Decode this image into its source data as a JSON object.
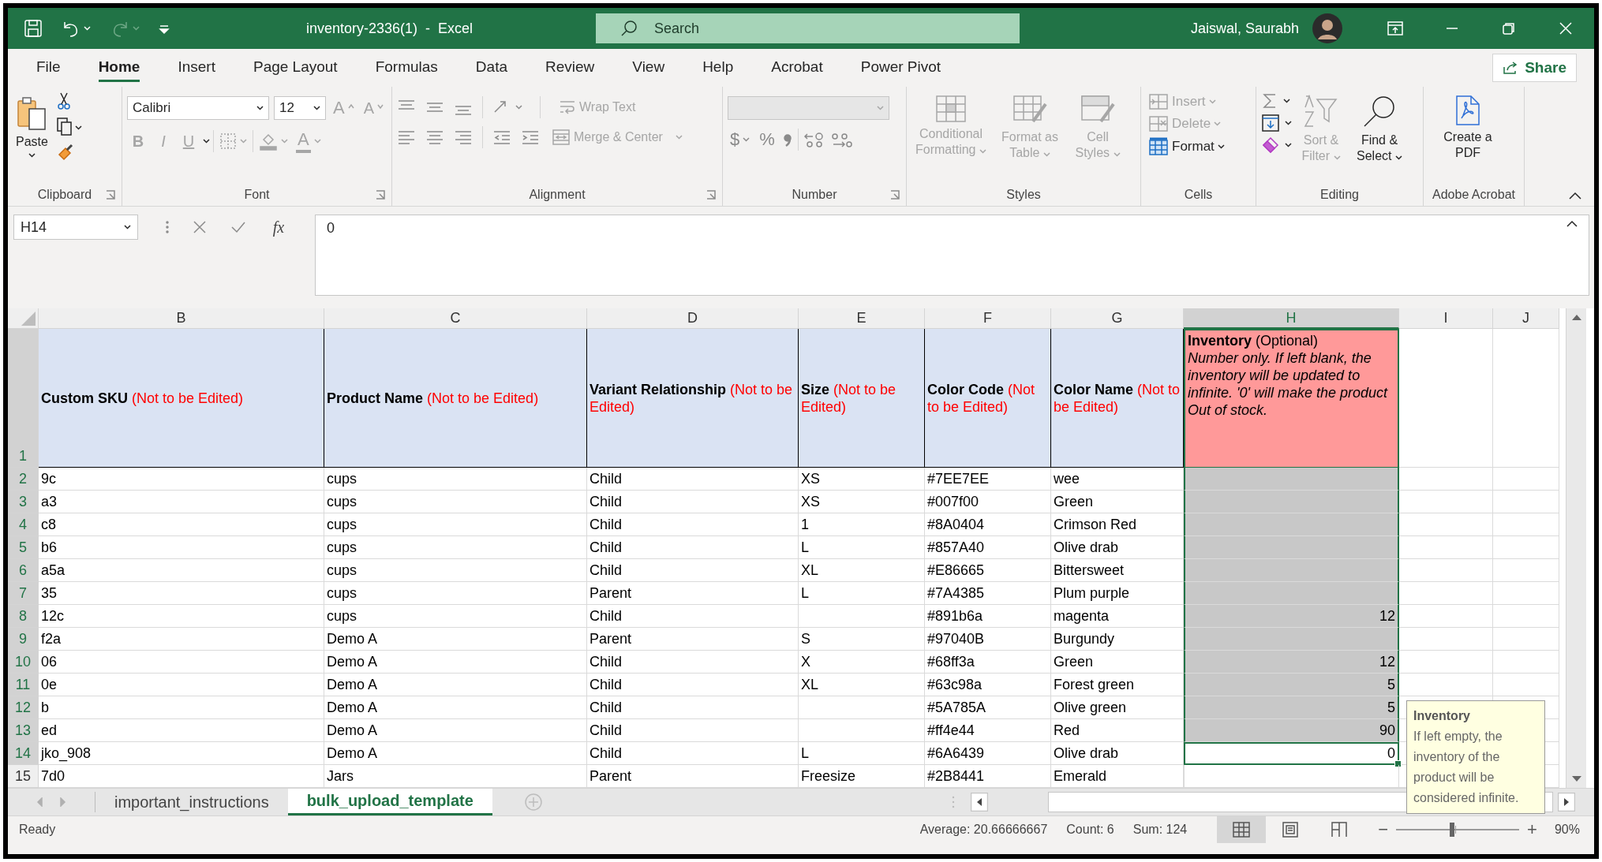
{
  "window": {
    "title": "inventory-2336(1)  -  Excel",
    "search_placeholder": "Search",
    "user": "Jaiswal, Saurabh"
  },
  "quick_access": [
    {
      "kind": "save",
      "disabled": false
    },
    {
      "kind": "undo",
      "disabled": false
    },
    {
      "kind": "redo",
      "disabled": true
    },
    {
      "kind": "customize",
      "disabled": false
    }
  ],
  "tabs": [
    {
      "label": "File",
      "selected": false
    },
    {
      "label": "Home",
      "selected": true
    },
    {
      "label": "Insert",
      "selected": false
    },
    {
      "label": "Page Layout",
      "selected": false
    },
    {
      "label": "Formulas",
      "selected": false
    },
    {
      "label": "Data",
      "selected": false
    },
    {
      "label": "Review",
      "selected": false
    },
    {
      "label": "View",
      "selected": false
    },
    {
      "label": "Help",
      "selected": false
    },
    {
      "label": "Acrobat",
      "selected": false
    },
    {
      "label": "Power Pivot",
      "selected": false
    }
  ],
  "share": "Share",
  "ribbon": {
    "clipboard": {
      "paste": "Paste",
      "label": "Clipboard"
    },
    "font": {
      "name": "Calibri",
      "size": "12",
      "grow": "A",
      "shrink": "A",
      "styles": [
        {
          "label": "B",
          "disabled": true
        },
        {
          "label": "I",
          "disabled": true
        },
        {
          "label": "U",
          "disabled": true
        }
      ],
      "color_button": "A",
      "label": "Font"
    },
    "alignment": {
      "wrap": {
        "label": "Wrap Text",
        "disabled": true
      },
      "merge": {
        "label": "Merge & Center",
        "disabled": true
      },
      "label": "Alignment"
    },
    "number": {
      "format_disabled": true,
      "currency": "$",
      "percent": "%",
      "label": "Number"
    },
    "styles": {
      "items": [
        {
          "kind": "conditional",
          "label": "Conditional Formatting",
          "disabled": true
        },
        {
          "kind": "table",
          "label": "Format as Table",
          "disabled": true
        },
        {
          "kind": "cell",
          "label": "Cell Styles",
          "disabled": true
        }
      ],
      "label": "Styles"
    },
    "cells": {
      "items": [
        {
          "kind": "insert",
          "label": "Insert",
          "disabled": true
        },
        {
          "kind": "delete",
          "label": "Delete",
          "disabled": true
        },
        {
          "kind": "format",
          "label": "Format",
          "disabled": false
        }
      ],
      "label": "Cells"
    },
    "editing": {
      "items": [
        {
          "kind": "sort",
          "label": "Sort & Filter",
          "disabled": true
        },
        {
          "kind": "find",
          "label": "Find & Select",
          "disabled": false
        }
      ],
      "label": "Editing"
    },
    "acrobat": {
      "button": "Create a PDF",
      "label": "Adobe Acrobat"
    }
  },
  "formula_bar": {
    "name_box": "H14",
    "fx": "fx",
    "value": "0"
  },
  "columns": [
    {
      "letter": "B",
      "selected": false
    },
    {
      "letter": "C",
      "selected": false
    },
    {
      "letter": "D",
      "selected": false
    },
    {
      "letter": "E",
      "selected": false
    },
    {
      "letter": "F",
      "selected": false
    },
    {
      "letter": "G",
      "selected": false
    },
    {
      "letter": "H",
      "selected": true
    },
    {
      "letter": "I",
      "selected": false
    },
    {
      "letter": "J",
      "selected": false
    }
  ],
  "header_row": {
    "number": "1",
    "selected": true,
    "cells": [
      {
        "kind": "locked",
        "label": "Custom SKU",
        "note": "(Not to be Edited)"
      },
      {
        "kind": "locked",
        "label": "Product Name",
        "note": "(Not to be Edited)"
      },
      {
        "kind": "locked",
        "label": "Variant Relationship",
        "note": "(Not to be Edited)"
      },
      {
        "kind": "locked",
        "label": "Size",
        "note": "(Not to be Edited)"
      },
      {
        "kind": "locked",
        "label": "Color Code",
        "note": "(Not to be Edited)"
      },
      {
        "kind": "locked",
        "label": "Color Name",
        "note": "(Not to be Edited)"
      },
      {
        "kind": "optional",
        "label": "Inventory",
        "note": "(Optional)",
        "description": "Number only. If left blank, the inventory will be updated to infinite. '0' will make the product Out of stock."
      }
    ]
  },
  "rows": [
    {
      "number": "2",
      "selected": true,
      "cells": [
        "9c",
        "cups",
        "Child",
        "XS",
        "#7EE7EE",
        "wee"
      ],
      "inventory": {
        "selected": true,
        "active": false
      }
    },
    {
      "number": "3",
      "selected": true,
      "cells": [
        "a3",
        "cups",
        "Child",
        "XS",
        "#007f00",
        "Green"
      ],
      "inventory": {
        "selected": true,
        "active": false
      }
    },
    {
      "number": "4",
      "selected": true,
      "cells": [
        "c8",
        "cups",
        "Child",
        "1",
        "#8A0404",
        "Crimson Red"
      ],
      "inventory": {
        "selected": true,
        "active": false
      }
    },
    {
      "number": "5",
      "selected": true,
      "cells": [
        "b6",
        "cups",
        "Child",
        "L",
        "#857A40",
        "Olive drab"
      ],
      "inventory": {
        "selected": true,
        "active": false
      }
    },
    {
      "number": "6",
      "selected": true,
      "cells": [
        "a5a",
        "cups",
        "Child",
        "XL",
        "#E86665",
        "Bittersweet"
      ],
      "inventory": {
        "selected": true,
        "active": false
      }
    },
    {
      "number": "7",
      "selected": true,
      "cells": [
        "35",
        "cups",
        "Parent",
        "L",
        "#7A4385",
        "Plum purple"
      ],
      "inventory": {
        "selected": true,
        "active": false
      }
    },
    {
      "number": "8",
      "selected": true,
      "cells": [
        "12c",
        "cups",
        "Child",
        "",
        "#891b6a",
        "magenta"
      ],
      "inventory": {
        "value": "12",
        "selected": true,
        "active": false
      }
    },
    {
      "number": "9",
      "selected": true,
      "cells": [
        "f2a",
        "Demo A",
        "Parent",
        "S",
        "#97040B",
        "Burgundy"
      ],
      "inventory": {
        "selected": true,
        "active": false
      }
    },
    {
      "number": "10",
      "selected": true,
      "cells": [
        "06",
        "Demo A",
        "Child",
        "X",
        "#68ff3a",
        "Green"
      ],
      "inventory": {
        "value": "12",
        "selected": true,
        "active": false
      }
    },
    {
      "number": "11",
      "selected": true,
      "cells": [
        "0e",
        "Demo A",
        "Child",
        "XL",
        "#63c98a",
        "Forest green"
      ],
      "inventory": {
        "value": "5",
        "selected": true,
        "active": false
      }
    },
    {
      "number": "12",
      "selected": true,
      "cells": [
        "b",
        "Demo A",
        "Child",
        "",
        "#5A785A",
        "Olive green"
      ],
      "inventory": {
        "value": "5",
        "selected": true,
        "active": false
      }
    },
    {
      "number": "13",
      "selected": true,
      "cells": [
        "ed",
        "Demo A",
        "Child",
        "",
        "#ff4e44",
        "Red"
      ],
      "inventory": {
        "value": "90",
        "selected": true,
        "active": false
      }
    },
    {
      "number": "14",
      "selected": true,
      "cells": [
        "jko_908",
        "Demo A",
        "Child",
        "L",
        "#6A6439",
        "Olive drab"
      ],
      "inventory": {
        "value": "0",
        "selected": false,
        "active": true
      }
    },
    {
      "number": "15",
      "selected": false,
      "cells": [
        "7d0",
        "Jars",
        "Parent",
        "Freesize",
        "#2B8441",
        "Emerald"
      ],
      "inventory": {
        "selected": false,
        "active": false
      }
    }
  ],
  "tooltip": {
    "title": "Inventory",
    "text": "If left empty, the inventory of the product will be considered infinite."
  },
  "sheet_tabs": [
    {
      "label": "important_instructions",
      "selected": false
    },
    {
      "label": "bulk_upload_template",
      "selected": true
    }
  ],
  "status": {
    "mode": "Ready",
    "stats": [
      "Average: 20.66666667",
      "Count: 6",
      "Sum: 124"
    ],
    "views": [
      {
        "kind": "normal",
        "selected": true
      },
      {
        "kind": "page_layout",
        "selected": false
      },
      {
        "kind": "page_break",
        "selected": false
      }
    ],
    "zoom_out": "−",
    "zoom_in": "+",
    "zoom": {
      "level": 0.45,
      "reading": "90%"
    }
  }
}
